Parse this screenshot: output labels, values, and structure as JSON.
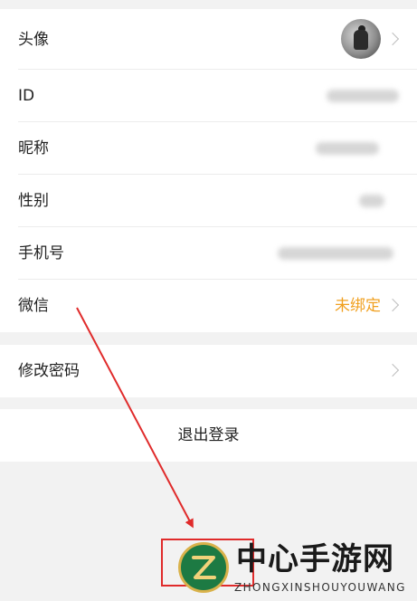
{
  "profile_rows": [
    {
      "label": "头像"
    },
    {
      "label": "ID"
    },
    {
      "label": "昵称"
    },
    {
      "label": "性别"
    },
    {
      "label": "手机号"
    },
    {
      "label": "微信",
      "value": "未绑定"
    }
  ],
  "password_row": {
    "label": "修改密码"
  },
  "logout_button": {
    "label": "退出登录"
  },
  "watermark": {
    "title": "中心手游网",
    "subtitle": "ZHONGXINSHOUYOUWANG"
  },
  "colors": {
    "accent": "#f0a020",
    "annotation": "#e02b2b",
    "background": "#f2f2f2"
  },
  "icons": [
    "chevron-right-icon",
    "avatar-image",
    "site-logo-icon"
  ]
}
